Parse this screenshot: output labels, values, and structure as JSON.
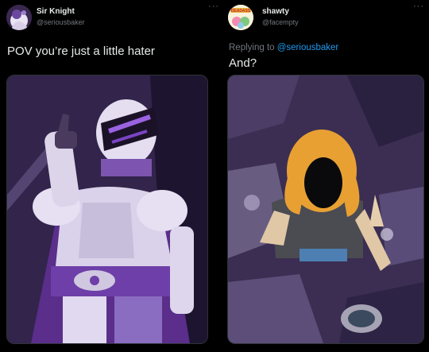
{
  "tweets": [
    {
      "display_name": "Sir Knight",
      "handle": "@seriousbaker",
      "more_label": "···",
      "text": "POV you’re just a little hater",
      "avatar_icon": "purple-character-avatar",
      "image_icon": "knight-middle-finger-illustration"
    },
    {
      "display_name": "shawty",
      "handle": "@facempty",
      "more_label": "···",
      "reply_prefix": "Replying to ",
      "reply_mention": "@seriousbaker",
      "text": "And?",
      "avatar_icon": "colorful-cartoon-avatar",
      "avatar_text": "DEADASS",
      "image_icon": "blonde-figure-middle-finger-illustration"
    }
  ],
  "colors": {
    "background": "#000000",
    "text": "#e7e9ea",
    "secondary": "#71767b",
    "link": "#1d9bf0",
    "border": "#2f3336"
  }
}
